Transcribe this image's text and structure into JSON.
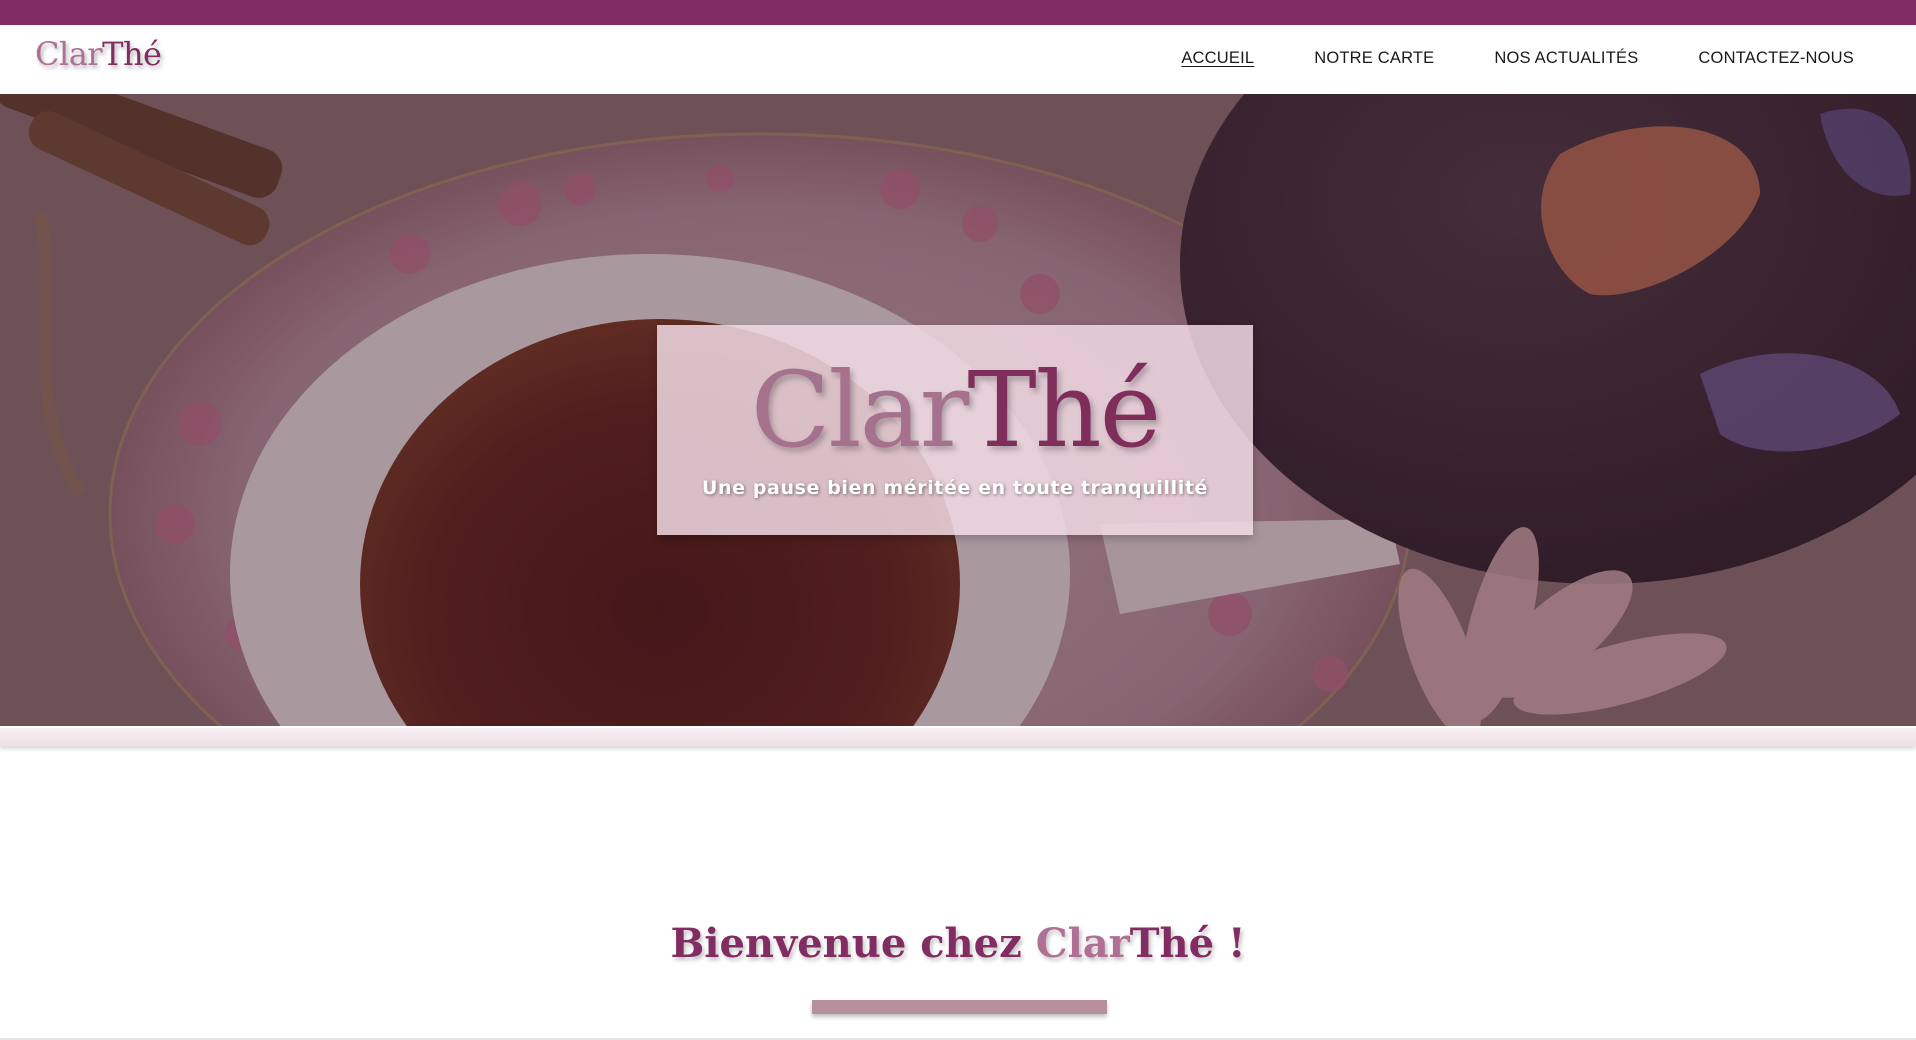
{
  "brand": {
    "part1": "Clar",
    "part2": "Thé"
  },
  "nav": {
    "items": [
      {
        "label": "ACCUEIL",
        "active": true
      },
      {
        "label": "NOTRE CARTE",
        "active": false
      },
      {
        "label": "NOS ACTUALITÉS",
        "active": false
      },
      {
        "label": "CONTACTEZ-NOUS",
        "active": false
      }
    ]
  },
  "hero": {
    "title_part1": "Clar",
    "title_part2": "Thé",
    "subtitle": "Une pause bien méritée en toute tranquillité"
  },
  "welcome": {
    "text_before": "Bienvenue chez ",
    "brand_part1": "Clar",
    "brand_part2": "Thé",
    "text_after": " !"
  },
  "colors": {
    "primary": "#812c62",
    "secondary": "#b06f94",
    "accent_bar": "#b88f9f"
  }
}
